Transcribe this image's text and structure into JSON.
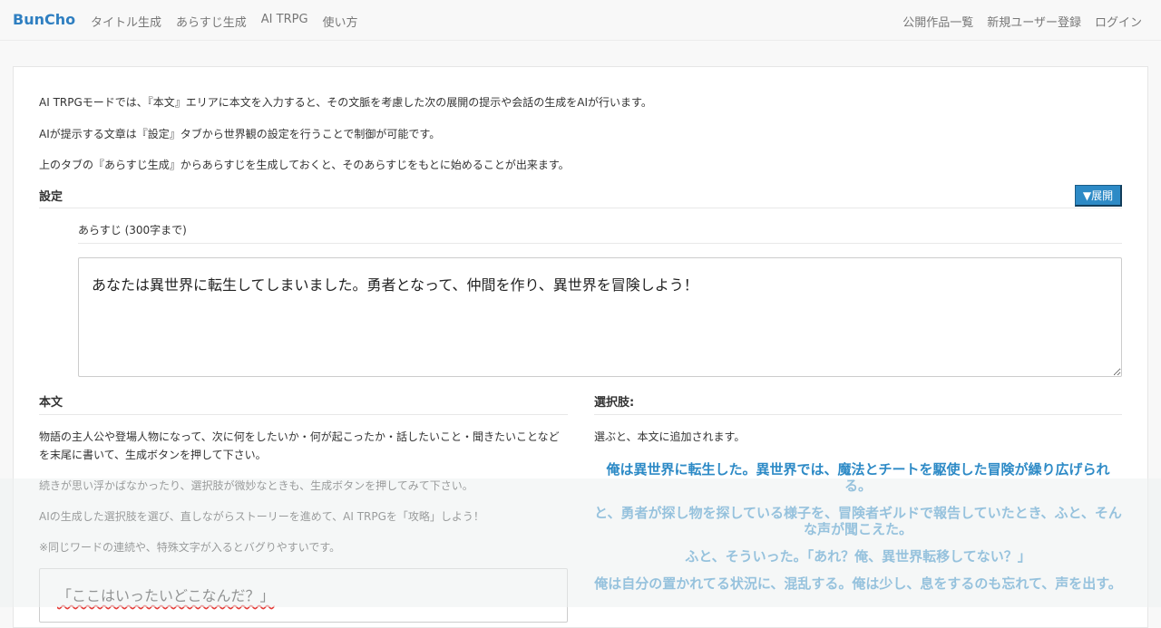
{
  "nav": {
    "brand": "BunCho",
    "left": [
      "タイトル生成",
      "あらすじ生成",
      "AI TRPG",
      "使い方"
    ],
    "right": [
      "公開作品一覧",
      "新規ユーザー登録",
      "ログイン"
    ]
  },
  "intro": [
    "AI TRPGモードでは、『本文』エリアに本文を入力すると、その文脈を考慮した次の展開の提示や会話の生成をAIが行います。",
    "AIが提示する文章は『設定』タブから世界観の設定を行うことで制御が可能です。",
    "上のタブの『あらすじ生成』からあらすじを生成しておくと、そのあらすじをもとに始めることが出来ます。"
  ],
  "settings": {
    "heading": "設定",
    "expand_label": "▼展開",
    "synopsis_label": "あらすじ (300字まで)",
    "synopsis_value": "あなたは異世界に転生してしまいました。勇者となって、仲間を作り、異世界を冒険しよう！"
  },
  "body_section": {
    "heading": "本文",
    "paragraphs": [
      "物語の主人公や登場人物になって、次に何をしたいか・何が起こったか・話したいこと・聞きたいことなどを末尾に書いて、生成ボタンを押して下さい。",
      "続きが思い浮かばなかったり、選択肢が微妙なときも、生成ボタンを押してみて下さい。",
      "AIの生成した選択肢を選び、直しながらストーリーを進めて、AI TRPGを「攻略」しよう！",
      "※同じワードの連続や、特殊文字が入るとバグりやすいです。"
    ],
    "text_value": "「ここはいったいどこなんだ？」"
  },
  "choices_section": {
    "heading": "選択肢:",
    "note": "選ぶと、本文に追加されます。",
    "items": [
      "俺は異世界に転生した。異世界では、魔法とチートを駆使した冒険が繰り広げられる。",
      "と、勇者が探し物を探している様子を、冒険者ギルドで報告していたとき、ふと、そんな声が聞こえた。",
      "ふと、そういった。「あれ？俺、異世界転移してない？」",
      "俺は自分の置かれてる状況に、混乱する。俺は少し、息をするのも忘れて、声を出す。"
    ]
  },
  "colors": {
    "accent": "#2d8ac6",
    "brand": "#2f7fc1"
  }
}
